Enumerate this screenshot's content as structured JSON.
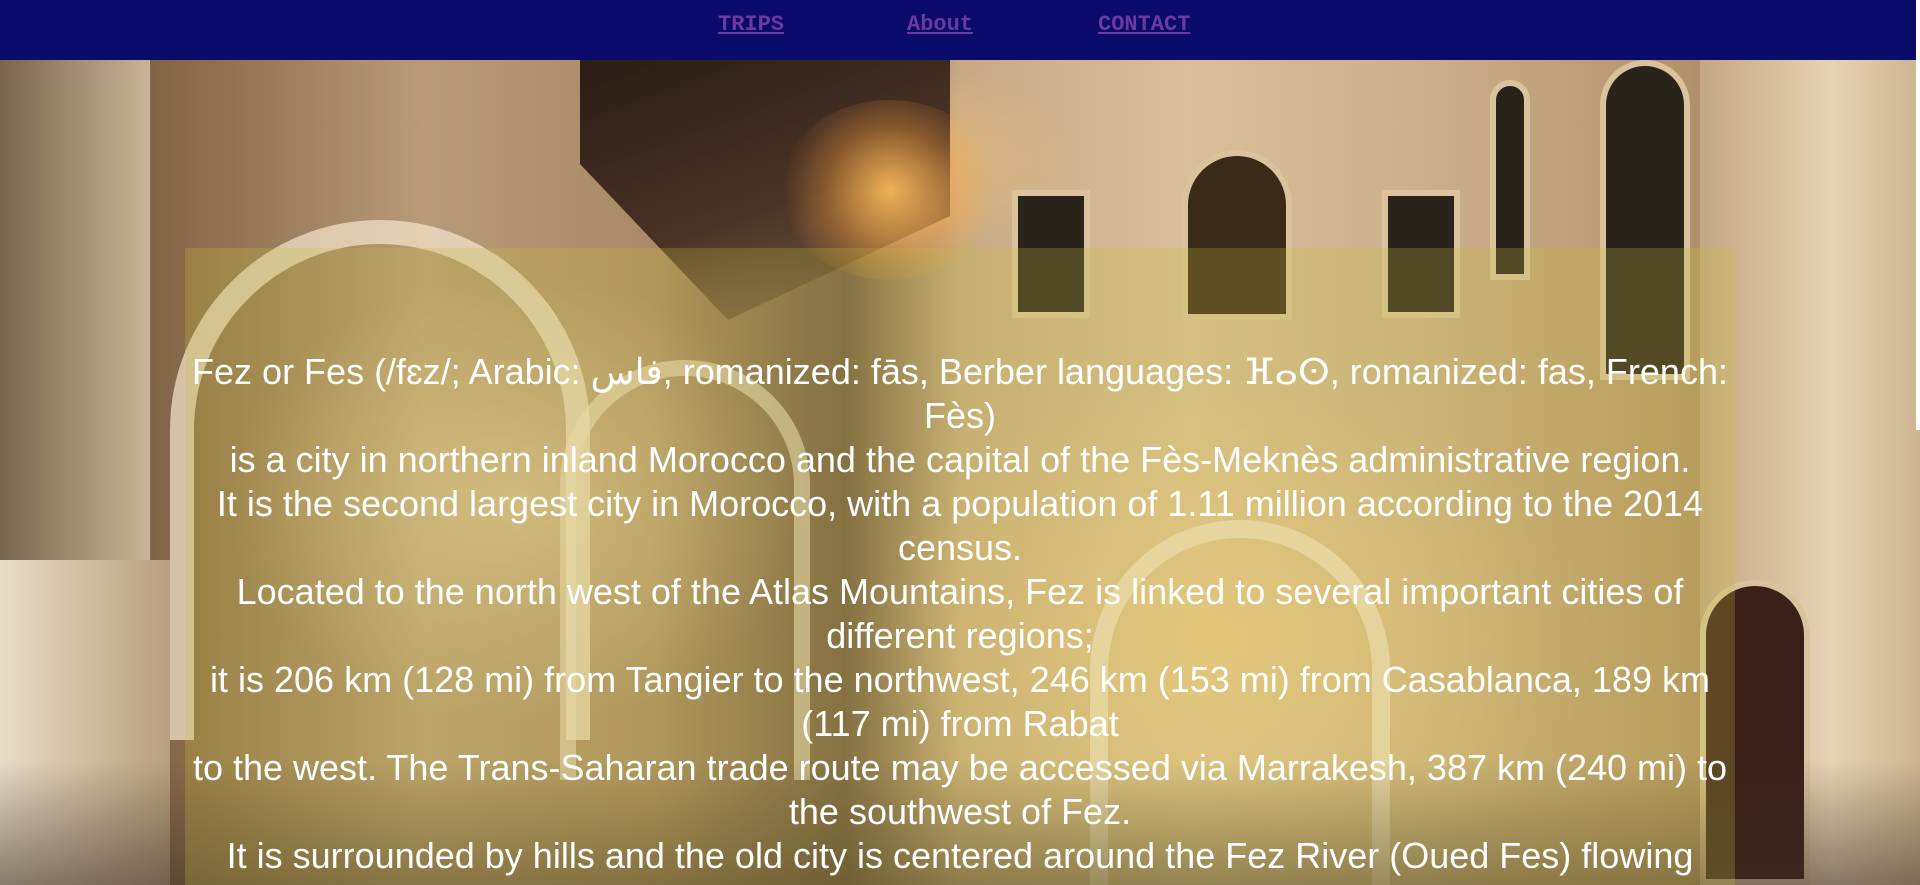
{
  "nav": {
    "links": [
      {
        "label": "TRIPS"
      },
      {
        "label": "About"
      },
      {
        "label": "CONTACT"
      }
    ],
    "background_color": "#0b0b6b",
    "link_color": "#6a3aa0"
  },
  "hero": {
    "image_description_icon": "riad-courtyard-photo",
    "panel_tint": "#c8be3c"
  },
  "description": {
    "lines": [
      "Fez or Fes (/fɛz/; Arabic: فاس, romanized: fās, Berber languages: ⴼⴰⵙ, romanized: fas, French: Fès)",
      "is a city in northern inland Morocco and the capital of the Fès-Meknès administrative region.",
      "It is the second largest city in Morocco, with a population of 1.11 million according to the 2014 census.",
      "Located to the north west of the Atlas Mountains, Fez is linked to several important cities of different regions;",
      "it is 206 km (128 mi) from Tangier to the northwest, 246 km (153 mi) from Casablanca, 189 km (117 mi) from Rabat",
      "to the west. The Trans-Saharan trade route may be accessed via Marrakesh, 387 km (240 mi) to the southwest of Fez.",
      "It is surrounded by hills and the old city is centered around the Fez River (Oued Fes) flowing"
    ],
    "text_color": "#ffffff"
  }
}
